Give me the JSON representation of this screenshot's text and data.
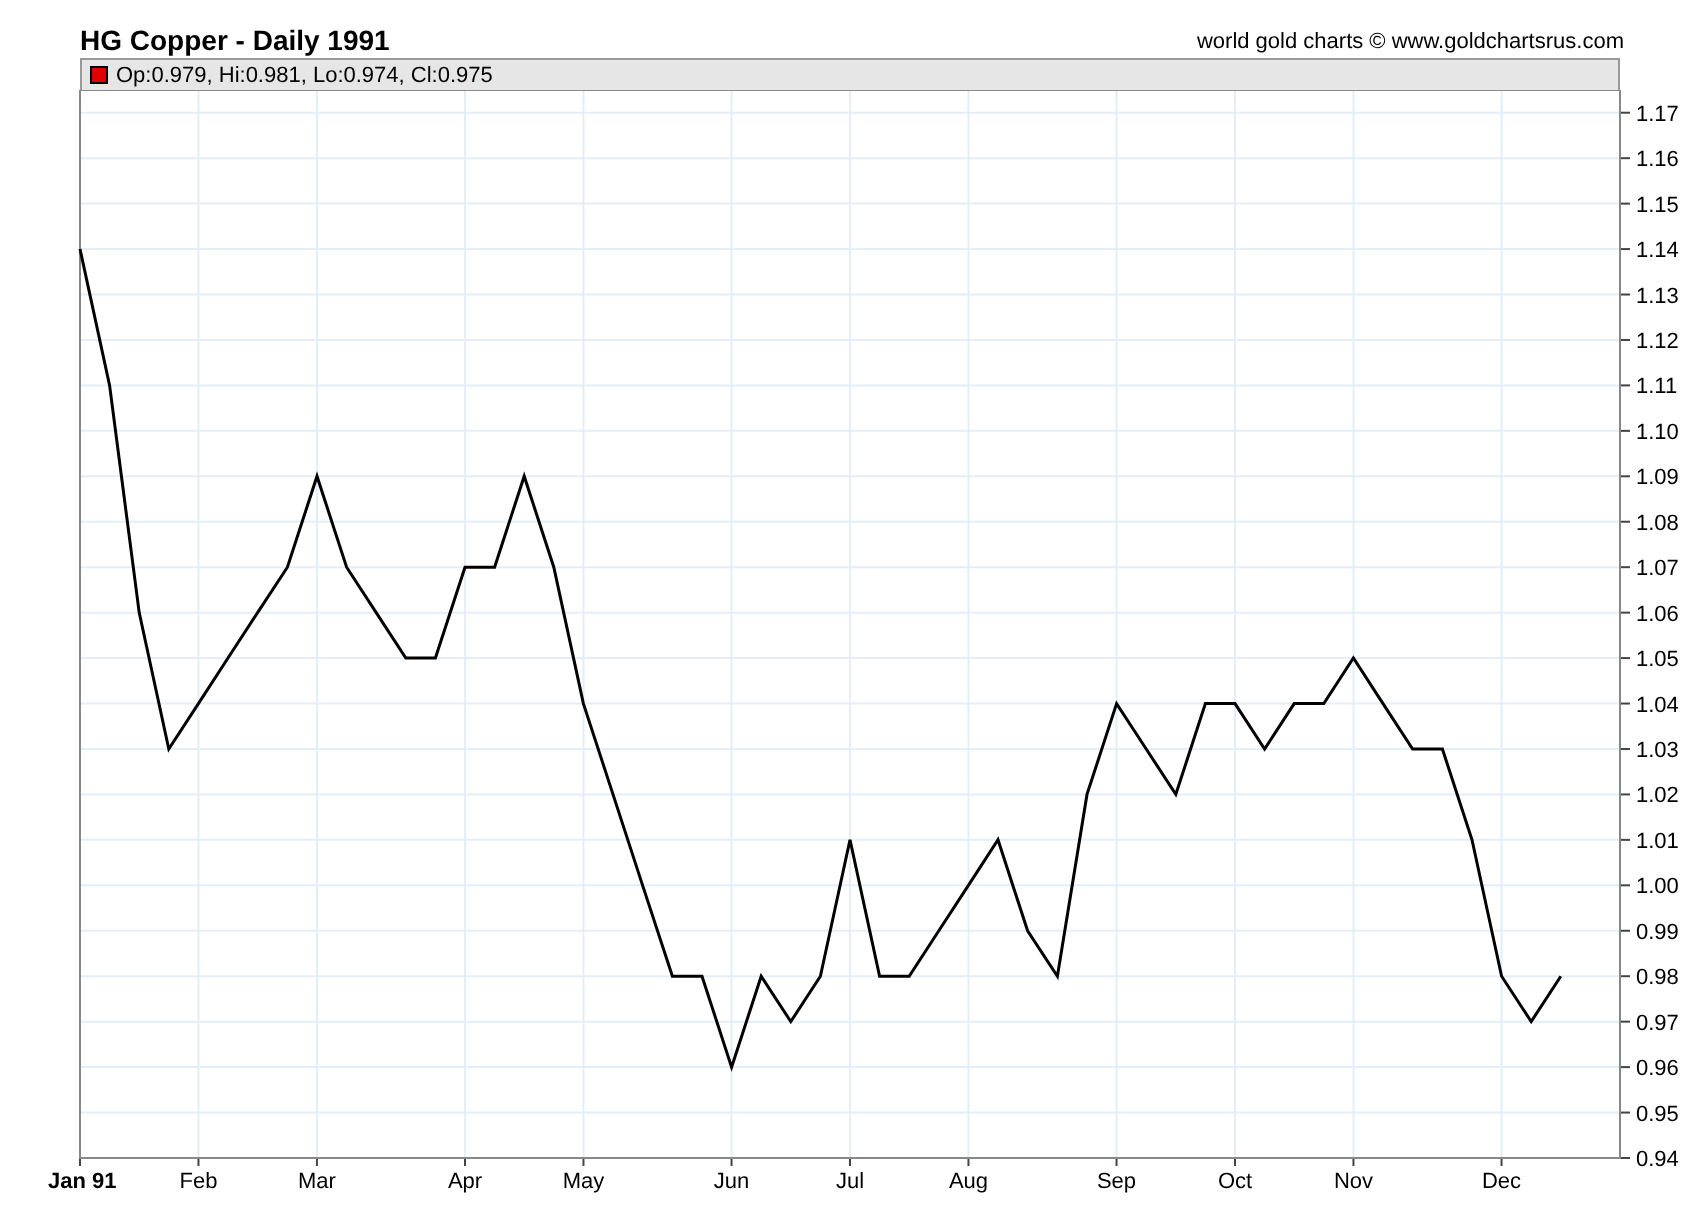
{
  "header": {
    "title": "HG Copper - Daily 1991",
    "source": "world gold charts © www.goldchartsrus.com"
  },
  "legend": {
    "text": "Op:0.979, Hi:0.981, Lo:0.974, Cl:0.975"
  },
  "chart_data": {
    "type": "line",
    "categories": [
      "Jan 91",
      null,
      null,
      null,
      "Feb",
      null,
      null,
      null,
      "Mar",
      null,
      null,
      null,
      null,
      "Apr",
      null,
      null,
      null,
      "May",
      null,
      null,
      null,
      null,
      "Jun",
      null,
      null,
      null,
      "Jul",
      null,
      null,
      null,
      "Aug",
      null,
      null,
      null,
      null,
      "Sep",
      null,
      null,
      null,
      "Oct",
      null,
      null,
      null,
      "Nov",
      null,
      null,
      null,
      null,
      "Dec",
      null,
      null
    ],
    "series": [
      {
        "color": "#000000",
        "values": [
          1.14,
          1.11,
          1.06,
          1.03,
          1.04,
          1.05,
          1.06,
          1.07,
          1.09,
          1.07,
          1.06,
          1.05,
          1.05,
          1.07,
          1.07,
          1.09,
          1.07,
          1.04,
          1.02,
          1.0,
          0.98,
          0.98,
          0.96,
          0.98,
          0.97,
          0.98,
          1.01,
          0.98,
          0.98,
          0.99,
          1.0,
          1.01,
          0.99,
          0.98,
          1.02,
          1.04,
          1.03,
          1.02,
          1.04,
          1.04,
          1.03,
          1.04,
          1.04,
          1.05,
          1.04,
          1.03,
          1.03,
          1.01,
          0.98,
          0.97,
          0.98
        ]
      }
    ],
    "ylim": [
      0.94,
      1.175
    ],
    "grid": true,
    "yticks": [
      {
        "value": 0.94,
        "label": "0.94"
      },
      {
        "value": 0.95,
        "label": "0.95"
      },
      {
        "value": 0.96,
        "label": "0.96"
      },
      {
        "value": 0.97,
        "label": "0.97"
      },
      {
        "value": 0.98,
        "label": "0.98"
      },
      {
        "value": 0.99,
        "label": "0.99"
      },
      {
        "value": 1.0,
        "label": "1.00"
      },
      {
        "value": 1.01,
        "label": "1.01"
      },
      {
        "value": 1.02,
        "label": "1.02"
      },
      {
        "value": 1.03,
        "label": "1.03"
      },
      {
        "value": 1.04,
        "label": "1.04"
      },
      {
        "value": 1.05,
        "label": "1.05"
      },
      {
        "value": 1.06,
        "label": "1.06"
      },
      {
        "value": 1.07,
        "label": "1.07"
      },
      {
        "value": 1.08,
        "label": "1.08"
      },
      {
        "value": 1.09,
        "label": "1.09"
      },
      {
        "value": 1.1,
        "label": "1.10"
      },
      {
        "value": 1.11,
        "label": "1.11"
      },
      {
        "value": 1.12,
        "label": "1.12"
      },
      {
        "value": 1.13,
        "label": "1.13"
      },
      {
        "value": 1.14,
        "label": "1.14"
      },
      {
        "value": 1.15,
        "label": "1.15"
      },
      {
        "value": 1.16,
        "label": "1.16"
      },
      {
        "value": 1.17,
        "label": "1.17"
      }
    ]
  }
}
